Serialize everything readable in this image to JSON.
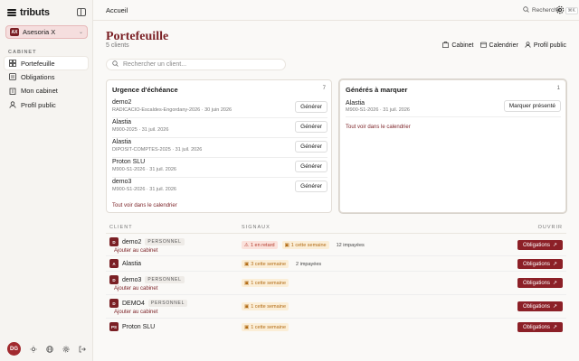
{
  "brand": {
    "name": "tributs"
  },
  "org": {
    "badge": "AX",
    "name": "Asesoria X"
  },
  "sidebar": {
    "section_label": "CABINET",
    "items": [
      {
        "label": "Portefeuille",
        "icon": "grid-icon",
        "active": true
      },
      {
        "label": "Obligations",
        "icon": "list-icon",
        "active": false
      },
      {
        "label": "Mon cabinet",
        "icon": "building-icon",
        "active": false
      },
      {
        "label": "Profil public",
        "icon": "user-icon",
        "active": false
      }
    ],
    "user_initials": "DG"
  },
  "topbar": {
    "breadcrumb": "Accueil",
    "search_label": "Rechercher",
    "search_kbd": "⌘K"
  },
  "page": {
    "title": "Portefeuille",
    "subtitle": "5 clients",
    "links": [
      "Cabinet",
      "Calendrier",
      "Profil public"
    ]
  },
  "search": {
    "placeholder": "Rechercher un client..."
  },
  "urgency": {
    "title": "Urgence d'échéance",
    "count": "7",
    "rows": [
      {
        "name": "demo2",
        "detail": "RADICACIO-Escaldes-Engordany-2026 · 30 juin 2026",
        "action": "Générer"
      },
      {
        "name": "Alastia",
        "detail": "M900-2025 · 31 juil. 2026",
        "action": "Générer"
      },
      {
        "name": "Alastia",
        "detail": "DIPOSIT-COMPTES-2025 · 31 juil. 2026",
        "action": "Générer"
      },
      {
        "name": "Proton SLU",
        "detail": "M900-S1-2026 · 31 juil. 2026",
        "action": "Générer"
      },
      {
        "name": "demo3",
        "detail": "M900-S1-2026 · 31 juil. 2026",
        "action": "Générer"
      }
    ],
    "footer_link": "Tout voir dans le calendrier"
  },
  "generated": {
    "title": "Générés à marquer",
    "count": "1",
    "rows": [
      {
        "name": "Alastia",
        "detail": "M900-S1-2026 · 31 juil. 2026",
        "action": "Marquer présenté"
      }
    ],
    "footer_link": "Tout voir dans le calendrier"
  },
  "table": {
    "headers": {
      "client": "CLIENT",
      "signals": "SIGNAUX",
      "open": "OUVRIR"
    },
    "tag_personnel": "PERSONNEL",
    "add_label": "Ajouter au cabinet",
    "button_label": "Obligations",
    "rows": [
      {
        "initial": "D",
        "name": "demo2",
        "tag": true,
        "add": true,
        "late": "1 en retard",
        "week": "1 cette semaine",
        "extra": "12 impayées"
      },
      {
        "initial": "A",
        "name": "Alastia",
        "tag": false,
        "add": false,
        "late": "",
        "week": "3 cette semaine",
        "extra": "2 impayées"
      },
      {
        "initial": "D",
        "name": "demo3",
        "tag": true,
        "add": true,
        "late": "",
        "week": "1 cette semaine",
        "extra": ""
      },
      {
        "initial": "D",
        "name": "DEMO4",
        "tag": true,
        "add": true,
        "late": "",
        "week": "1 cette semaine",
        "extra": ""
      },
      {
        "initial": "PS",
        "name": "Proton SLU",
        "tag": false,
        "add": false,
        "late": "",
        "week": "1 cette semaine",
        "extra": ""
      }
    ]
  },
  "colors": {
    "accent": "#7a1f24",
    "button": "#8c2027",
    "late": "#b23a2b",
    "week": "#b26b14"
  }
}
